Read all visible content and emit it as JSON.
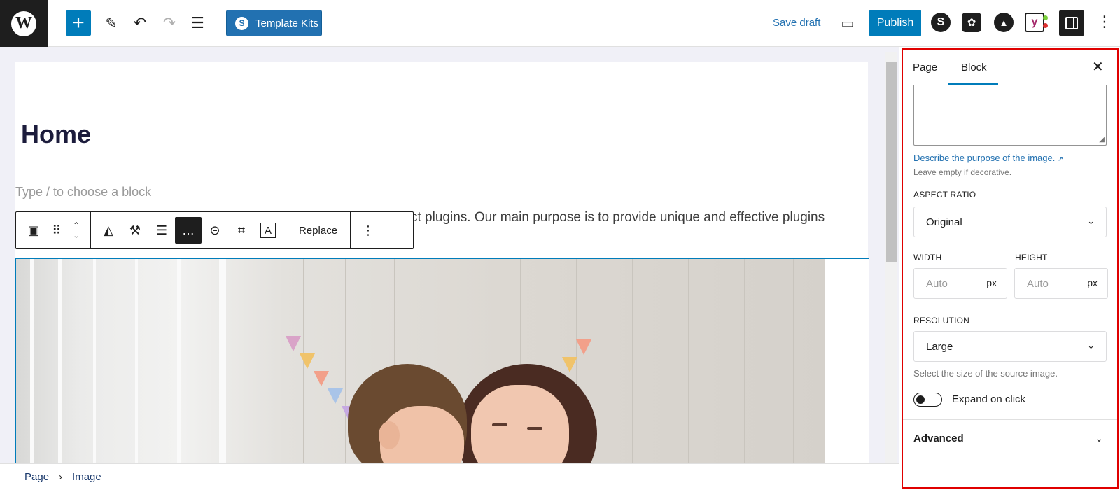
{
  "topbar": {
    "wp_logo": "W",
    "add_label": "+",
    "tools_icon": "✎",
    "undo_icon": "↶",
    "redo_icon": "↷",
    "list_view_icon": "☰",
    "template_kits_label": "Template Kits",
    "template_kits_icon": "S",
    "save_draft_label": "Save draft",
    "preview_icon": "▭",
    "publish_label": "Publish",
    "plugin_icons": [
      "S",
      "✿",
      "▲",
      "y"
    ],
    "more_icon": "⋮"
  },
  "editor": {
    "page_title": "Home",
    "block_placeholder": "Type / to choose a block",
    "paragraph_text": "ct plugins. Our main purpose is to provide unique and effective plugins",
    "toolbar": {
      "image_icon": "▣",
      "drag_icon": "⠿",
      "move_up": "⌃",
      "move_down": "⌄",
      "duotone_icon": "◭",
      "filter_icon": "⚒",
      "align_icon": "☰",
      "caption_icon": "…",
      "link_icon": "⊝",
      "crop_icon": "⌗",
      "text_overlay_icon": "A",
      "replace_label": "Replace",
      "more_icon": "⋮"
    }
  },
  "breadcrumb": {
    "items": [
      "Page",
      "Image"
    ],
    "separator": "›"
  },
  "sidebar": {
    "tabs": [
      "Page",
      "Block"
    ],
    "active_tab": "Block",
    "close_icon": "✕",
    "alt_help_link": "Describe the purpose of the image.",
    "alt_help_link_icon": "↗",
    "alt_help_sub": "Leave empty if decorative.",
    "aspect_ratio_label": "ASPECT RATIO",
    "aspect_ratio_value": "Original",
    "width_label": "WIDTH",
    "height_label": "HEIGHT",
    "width_placeholder": "Auto",
    "height_placeholder": "Auto",
    "unit": "px",
    "resolution_label": "RESOLUTION",
    "resolution_value": "Large",
    "resolution_help": "Select the size of the source image.",
    "expand_label": "Expand on click",
    "expand_on": false,
    "advanced_label": "Advanced",
    "chevron_icon": "⌄"
  },
  "colors": {
    "accent": "#007cba",
    "highlight_border": "#e00000"
  }
}
